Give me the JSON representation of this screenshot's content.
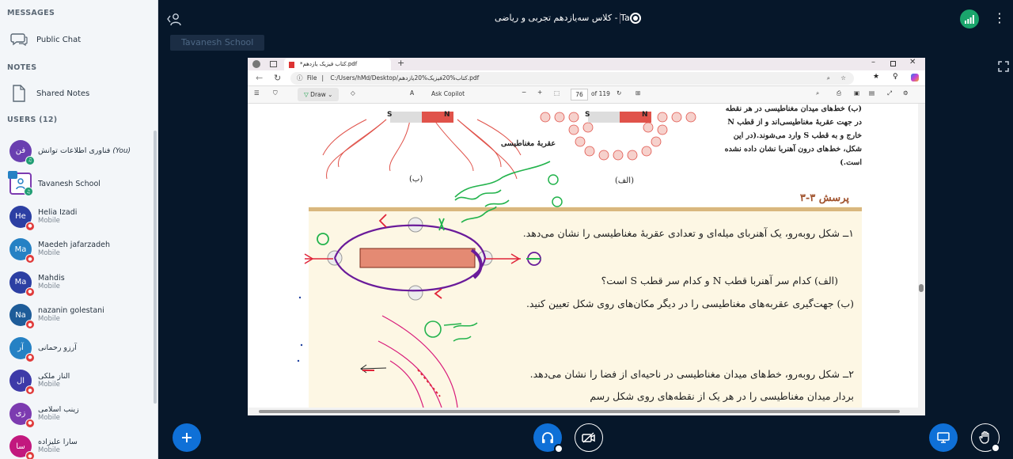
{
  "sidebar": {
    "messages_title": "MESSAGES",
    "public_chat": "Public Chat",
    "notes_title": "NOTES",
    "shared_notes": "Shared Notes",
    "users_title": "USERS (12)",
    "users": [
      {
        "initials": "فن",
        "name": "فناوری اطلاعات توانش",
        "role": "",
        "you": "(You)",
        "color": "#6a3fb0"
      },
      {
        "initials": "",
        "name": "Tavanesh School",
        "role": "",
        "you": "",
        "color": "#ffffff"
      },
      {
        "initials": "He",
        "name": "Helia Izadi",
        "role": "Mobile",
        "you": "",
        "color": "#2c3fa3"
      },
      {
        "initials": "Ma",
        "name": "Maedeh jafarzadeh",
        "role": "Mobile",
        "you": "",
        "color": "#2581c4"
      },
      {
        "initials": "Ma",
        "name": "Mahdis",
        "role": "Mobile",
        "you": "",
        "color": "#2c3fa3"
      },
      {
        "initials": "Na",
        "name": "nazanin golestani",
        "role": "Mobile",
        "you": "",
        "color": "#1e5c99"
      },
      {
        "initials": "آر",
        "name": "آرزو رحمانی",
        "role": "",
        "you": "",
        "color": "#2581c4"
      },
      {
        "initials": "ال",
        "name": "الناز ملکی",
        "role": "Mobile",
        "you": "",
        "color": "#3d3aa8"
      },
      {
        "initials": "زی",
        "name": "زینب اسلامی",
        "role": "Mobile",
        "you": "",
        "color": "#7c3bb0"
      },
      {
        "initials": "سا",
        "name": "سارا علیزاده",
        "role": "Mobile",
        "you": "",
        "color": "#c2187e"
      }
    ]
  },
  "topbar": {
    "title": "کلاس سه‌یازدهم تجربی و ریاضی - Ta"
  },
  "presenter": "Tavanesh School",
  "browser": {
    "tab_label": "*کتاب فیزیک یازدهم.pdf",
    "file_label": "File",
    "url": "C:/Users/hMd/Desktop/کتاب%20فیزیک%20یازدهم.pdf",
    "draw_label": "Draw",
    "copilot_label": "Ask Copilot",
    "page_current": "76",
    "page_total": "of 119"
  },
  "pdf": {
    "top_right_text": "(ب) خط‌های میدان مغناطیسی در هر نقطه در جهت عقربهٔ مغناطیسی‌اند و از قطب N خارج و به قطب S وارد می‌شوند.(در این شکل، خط‌های درون آهنربا نشان داده نشده است.)",
    "compass_label": "عقربهٔ مغناطیسی",
    "fig_b": "(ب)",
    "fig_a": "(الف)",
    "section_title": "پرسش ۳-۳",
    "q1": "۱ــ شکل روبه‌رو، یک آهنربای میله‌ای و تعدادی عقربهٔ مغناطیسی را نشان می‌دهد.",
    "q1a": "(الف) کدام سر آهنربا قطب N و کدام سر قطب S است؟",
    "q1b": "(ب) جهت‌گیری عقربه‌های مغناطیسی را در دیگر مکان‌های روی شکل تعیین کنید.",
    "q2": "۲ــ شکل روبه‌رو، خط‌های میدان مغناطیسی در ناحیه‌ای از فضا را نشان می‌دهد. بردار میدان مغناطیسی را در هر یک از نقطه‌های روی شکل رسم",
    "magnet_s": "S",
    "magnet_n": "N",
    "bar_labels": [
      "S",
      "N"
    ]
  },
  "colors": {
    "sidebar_bg": "#f3f6f9",
    "main_bg": "#06172a",
    "accent_blue": "#0f70d7",
    "pdf_cream": "#fdf7e4",
    "pdf_band": "#d9b77e"
  }
}
